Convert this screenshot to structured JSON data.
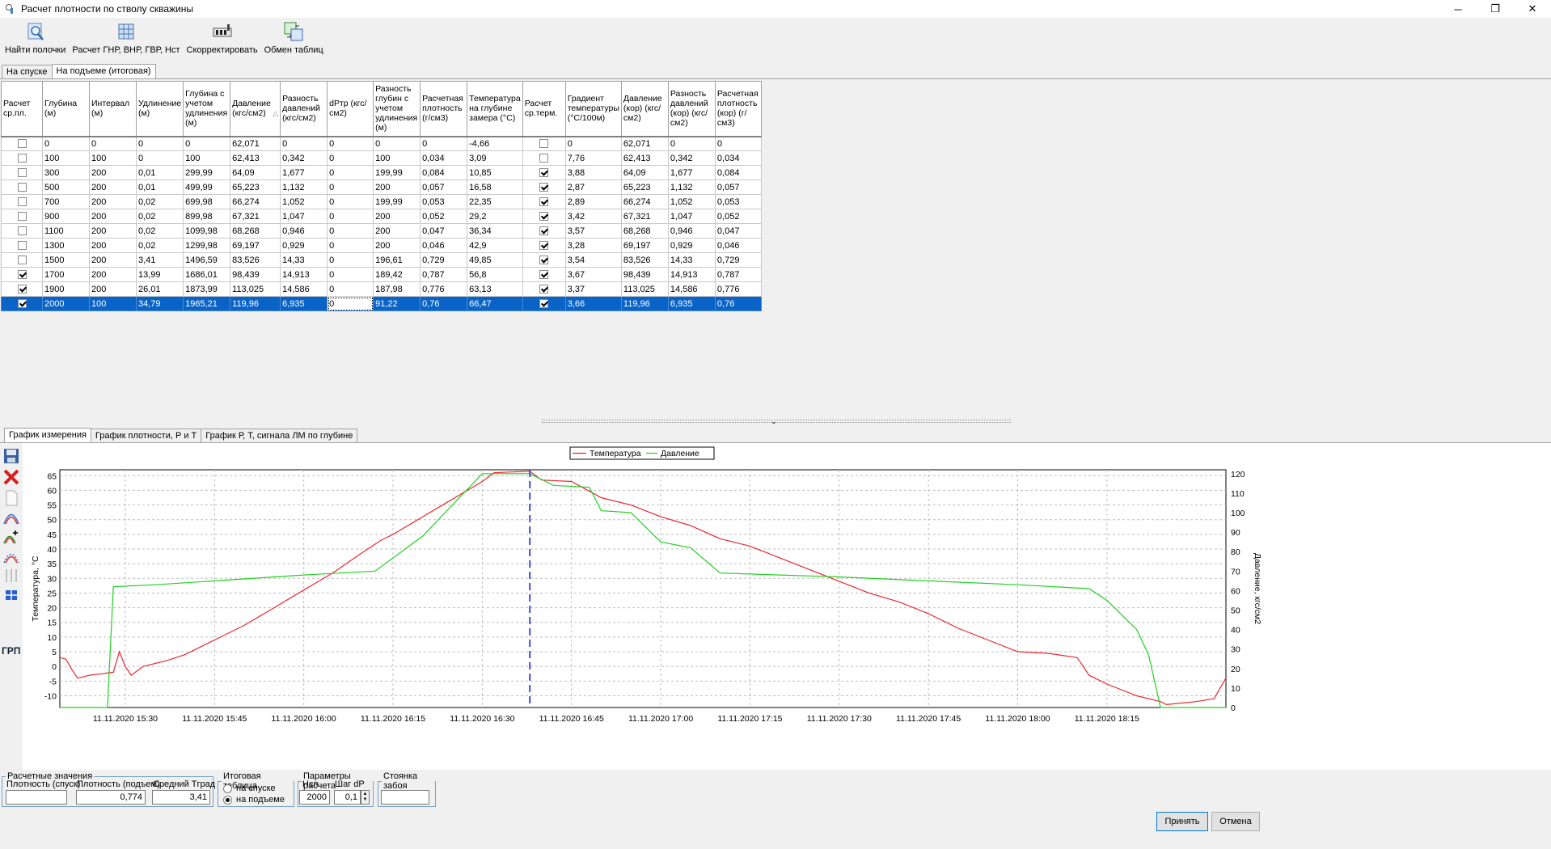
{
  "window": {
    "title": "Расчет плотности по стволу скважины",
    "controls": {
      "minimize": "─",
      "maximize": "❐",
      "close": "✕"
    }
  },
  "toolbar": [
    {
      "name": "find-shelves-button",
      "icon": "magnifier-doc-icon",
      "label": "Найти полочки"
    },
    {
      "name": "calc-gnr-button",
      "icon": "grid-calc-icon",
      "label": "Расчет ГНР, ВНР, ГВР, Нст"
    },
    {
      "name": "correct-button",
      "icon": "adjust-icon",
      "label": "Скорректировать"
    },
    {
      "name": "exchange-tables-button",
      "icon": "tables-exchange-icon",
      "label": "Обмен таблиц"
    }
  ],
  "top_tabs": [
    {
      "label": "На спуске",
      "active": false
    },
    {
      "label": "На подъеме (итоговая)",
      "active": true
    }
  ],
  "grid": {
    "columns": [
      "Расчет ср.пл.",
      "Глубина (м)",
      "Интервал (м)",
      "Удлинение (м)",
      "Глубина с учетом удлинения (м)",
      "Давление (кгс/см2)",
      "Разность давлений (кгс/см2)",
      "dPтр (кгс/см2)",
      "Разность глубин с учетом удлинения (м)",
      "Расчетная плотность (г/см3)",
      "Температура на глубине замера (°С)",
      "Расчет ср.терм.",
      "Градиент температуры (°С/100м)",
      "Давление (кор) (кгс/см2)",
      "Разность давлений (кор) (кгс/см2)",
      "Расчетная плотность (кор) (г/см3)"
    ],
    "sort_glyph": "△",
    "rows": [
      {
        "c1": false,
        "d": [
          "0",
          "0",
          "0",
          "0",
          "62,071",
          "0",
          "0",
          "0",
          "0",
          "-4,66"
        ],
        "c2": false,
        "e": [
          "0",
          "62,071",
          "0",
          "0"
        ],
        "sel": false
      },
      {
        "c1": false,
        "d": [
          "100",
          "100",
          "0",
          "100",
          "62,413",
          "0,342",
          "0",
          "100",
          "0,034",
          "3,09"
        ],
        "c2": false,
        "e": [
          "7,76",
          "62,413",
          "0,342",
          "0,034"
        ],
        "sel": false
      },
      {
        "c1": false,
        "d": [
          "300",
          "200",
          "0,01",
          "299,99",
          "64,09",
          "1,677",
          "0",
          "199,99",
          "0,084",
          "10,85"
        ],
        "c2": true,
        "e": [
          "3,88",
          "64,09",
          "1,677",
          "0,084"
        ],
        "sel": false
      },
      {
        "c1": false,
        "d": [
          "500",
          "200",
          "0,01",
          "499,99",
          "65,223",
          "1,132",
          "0",
          "200",
          "0,057",
          "16,58"
        ],
        "c2": true,
        "e": [
          "2,87",
          "65,223",
          "1,132",
          "0,057"
        ],
        "sel": false
      },
      {
        "c1": false,
        "d": [
          "700",
          "200",
          "0,02",
          "699,98",
          "66,274",
          "1,052",
          "0",
          "199,99",
          "0,053",
          "22,35"
        ],
        "c2": true,
        "e": [
          "2,89",
          "66,274",
          "1,052",
          "0,053"
        ],
        "sel": false
      },
      {
        "c1": false,
        "d": [
          "900",
          "200",
          "0,02",
          "899,98",
          "67,321",
          "1,047",
          "0",
          "200",
          "0,052",
          "29,2"
        ],
        "c2": true,
        "e": [
          "3,42",
          "67,321",
          "1,047",
          "0,052"
        ],
        "sel": false
      },
      {
        "c1": false,
        "d": [
          "1100",
          "200",
          "0,02",
          "1099,98",
          "68,268",
          "0,946",
          "0",
          "200",
          "0,047",
          "36,34"
        ],
        "c2": true,
        "e": [
          "3,57",
          "68,268",
          "0,946",
          "0,047"
        ],
        "sel": false
      },
      {
        "c1": false,
        "d": [
          "1300",
          "200",
          "0,02",
          "1299,98",
          "69,197",
          "0,929",
          "0",
          "200",
          "0,046",
          "42,9"
        ],
        "c2": true,
        "e": [
          "3,28",
          "69,197",
          "0,929",
          "0,046"
        ],
        "sel": false
      },
      {
        "c1": false,
        "d": [
          "1500",
          "200",
          "3,41",
          "1496,59",
          "83,526",
          "14,33",
          "0",
          "196,61",
          "0,729",
          "49,85"
        ],
        "c2": true,
        "e": [
          "3,54",
          "83,526",
          "14,33",
          "0,729"
        ],
        "sel": false
      },
      {
        "c1": true,
        "d": [
          "1700",
          "200",
          "13,99",
          "1686,01",
          "98,439",
          "14,913",
          "0",
          "189,42",
          "0,787",
          "56,8"
        ],
        "c2": true,
        "e": [
          "3,67",
          "98,439",
          "14,913",
          "0,787"
        ],
        "sel": false
      },
      {
        "c1": true,
        "d": [
          "1900",
          "200",
          "26,01",
          "1873,99",
          "113,025",
          "14,586",
          "0",
          "187,98",
          "0,776",
          "63,13"
        ],
        "c2": true,
        "e": [
          "3,37",
          "113,025",
          "14,586",
          "0,776"
        ],
        "sel": false
      },
      {
        "c1": true,
        "d": [
          "2000",
          "100",
          "34,79",
          "1965,21",
          "119,96",
          "6,935",
          "0",
          "91,22",
          "0,76",
          "66,47"
        ],
        "c2": true,
        "e": [
          "3,66",
          "119,96",
          "6,935",
          "0,76"
        ],
        "sel": true
      }
    ]
  },
  "chart_tabs": [
    {
      "label": "График измерения",
      "active": true
    },
    {
      "label": "График плотности, Р и Т",
      "active": false
    },
    {
      "label": "График Р, Т, сигнала ЛМ по глубине",
      "active": false
    }
  ],
  "side_tools": {
    "icons": [
      "save-icon",
      "delete-icon",
      "document-icon",
      "curve-icon",
      "curve-add-icon",
      "curve-edit-icon",
      "curve-split-icon",
      "fit-icon"
    ],
    "grp_label": "ГРП"
  },
  "chart_data": {
    "type": "line",
    "legend": [
      "Температура",
      "Давление"
    ],
    "legend_position": "top-center",
    "y_left": {
      "label": "Температура, °С",
      "min": -14,
      "max": 67,
      "ticks": [
        65,
        60,
        55,
        50,
        45,
        40,
        35,
        30,
        25,
        20,
        15,
        10,
        5,
        0,
        -5,
        -10
      ]
    },
    "y_right": {
      "label": "Давление, кгс/см2",
      "min": 0,
      "max": 122,
      "ticks": [
        120,
        110,
        100,
        90,
        80,
        70,
        60,
        50,
        40,
        30,
        20,
        10,
        0
      ]
    },
    "x": {
      "min": "15:19",
      "max": "18:35",
      "ticks": [
        "11.11.2020 15:30",
        "11.11.2020 15:45",
        "11.11.2020 16:00",
        "11.11.2020 16:15",
        "11.11.2020 16:30",
        "11.11.2020 16:45",
        "11.11.2020 17:00",
        "11.11.2020 17:15",
        "11.11.2020 17:30",
        "11.11.2020 17:45",
        "11.11.2020 18:00",
        "11.11.2020 18:15"
      ]
    },
    "grid": true,
    "marker_time": "16:38",
    "colors": {
      "temperature": "#e8282e",
      "pressure": "#22d022",
      "marker": "#2a3cd6"
    },
    "series": [
      {
        "name": "Температура",
        "axis": "left",
        "points": [
          [
            "15:19",
            3
          ],
          [
            "15:20",
            2.5
          ],
          [
            "15:21",
            -1
          ],
          [
            "15:22",
            -4
          ],
          [
            "15:24",
            -3
          ],
          [
            "15:26",
            -2.5
          ],
          [
            "15:28",
            -2
          ],
          [
            "15:29",
            5
          ],
          [
            "15:30",
            0
          ],
          [
            "15:31",
            -3
          ],
          [
            "15:33",
            0
          ],
          [
            "15:37",
            2
          ],
          [
            "15:40",
            4
          ],
          [
            "15:45",
            9
          ],
          [
            "15:50",
            14
          ],
          [
            "15:55",
            20
          ],
          [
            "16:00",
            26
          ],
          [
            "16:05",
            32
          ],
          [
            "16:10",
            39
          ],
          [
            "16:13",
            43
          ],
          [
            "16:15",
            45
          ],
          [
            "16:20",
            51
          ],
          [
            "16:25",
            57
          ],
          [
            "16:30",
            63
          ],
          [
            "16:32",
            66
          ],
          [
            "16:38",
            66.5
          ],
          [
            "16:40",
            63.5
          ],
          [
            "16:45",
            63
          ],
          [
            "16:50",
            57.5
          ],
          [
            "16:55",
            55
          ],
          [
            "17:00",
            51
          ],
          [
            "17:05",
            48
          ],
          [
            "17:10",
            43.5
          ],
          [
            "17:15",
            41
          ],
          [
            "17:20",
            37
          ],
          [
            "17:25",
            33
          ],
          [
            "17:30",
            29
          ],
          [
            "17:35",
            25
          ],
          [
            "17:40",
            22
          ],
          [
            "17:45",
            18
          ],
          [
            "17:50",
            13
          ],
          [
            "17:55",
            9
          ],
          [
            "18:00",
            5
          ],
          [
            "18:05",
            4.5
          ],
          [
            "18:10",
            3
          ],
          [
            "18:12",
            -3
          ],
          [
            "18:15",
            -6
          ],
          [
            "18:20",
            -10
          ],
          [
            "18:24",
            -12
          ],
          [
            "18:25",
            -13
          ],
          [
            "18:30",
            -12
          ],
          [
            "18:33",
            -11
          ],
          [
            "18:35",
            -4
          ]
        ]
      },
      {
        "name": "Давление",
        "axis": "right",
        "points": [
          [
            "15:19",
            0
          ],
          [
            "15:27",
            0
          ],
          [
            "15:28",
            62
          ],
          [
            "15:35",
            63
          ],
          [
            "15:45",
            65
          ],
          [
            "16:00",
            68
          ],
          [
            "16:12",
            70
          ],
          [
            "16:20",
            88
          ],
          [
            "16:30",
            120
          ],
          [
            "16:38",
            120
          ],
          [
            "16:42",
            114
          ],
          [
            "16:48",
            113
          ],
          [
            "16:50",
            101
          ],
          [
            "16:55",
            100
          ],
          [
            "17:00",
            85
          ],
          [
            "17:05",
            82
          ],
          [
            "17:10",
            69
          ],
          [
            "17:20",
            68
          ],
          [
            "17:30",
            67
          ],
          [
            "17:45",
            65
          ],
          [
            "18:00",
            63
          ],
          [
            "18:12",
            61
          ],
          [
            "18:15",
            55
          ],
          [
            "18:20",
            40
          ],
          [
            "18:22",
            27
          ],
          [
            "18:24",
            0
          ],
          [
            "18:35",
            0
          ]
        ]
      }
    ]
  },
  "bottom": {
    "calc": {
      "legend": "Расчетные значения",
      "label1": "Плотность (спуск)",
      "value1": "",
      "label2": "Плотность (подъем)",
      "value2": "0,774",
      "label3": "Средний Тград",
      "value3": "3,41"
    },
    "summary": {
      "legend": "Итоговая таблица",
      "opt1": "на спуске",
      "opt2": "на подъеме",
      "selected": "на подъеме"
    },
    "params": {
      "legend": "Параметры расчета",
      "label1": "Нсп",
      "value1": "2000",
      "label2": "Шаг dP",
      "value2": "0,1"
    },
    "bottomhole": {
      "legend": "Стоянка забоя",
      "value": ""
    },
    "ok_label": "Принять",
    "cancel_label": "Отмена"
  }
}
